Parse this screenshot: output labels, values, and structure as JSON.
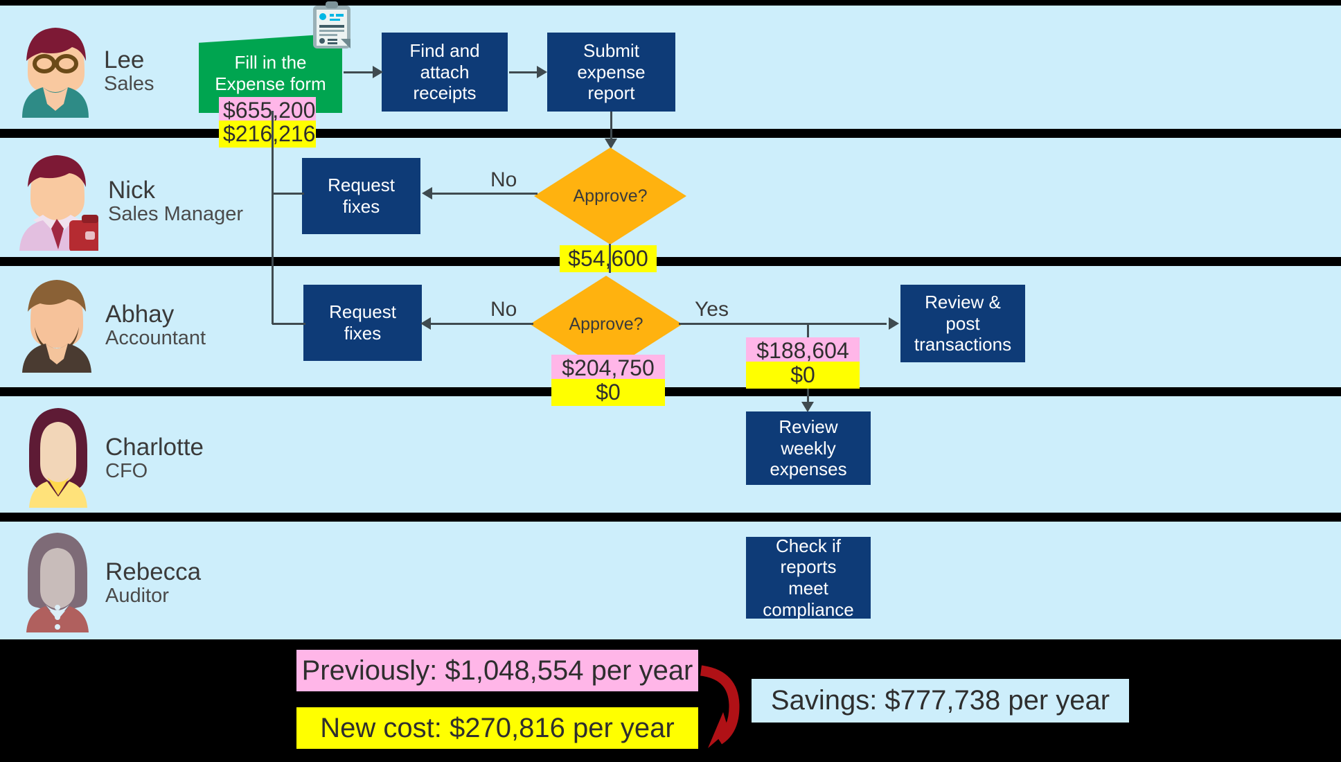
{
  "diagram": {
    "title": "Expense report process swimlane",
    "colors": {
      "lane_background": "#CDEEFB",
      "process_box": "#0E3B77",
      "start_box": "#00A550",
      "decision": "#FFB20F",
      "previous_cost_highlight": "#FFB6E8",
      "new_cost_highlight": "#FFFF00",
      "arrow": "#3f4a4f",
      "savings_arrow": "#B01116",
      "page_background": "#000000"
    }
  },
  "lanes": [
    {
      "name": "Lee",
      "role": "Sales"
    },
    {
      "name": "Nick",
      "role": "Sales Manager"
    },
    {
      "name": "Abhay",
      "role": "Accountant"
    },
    {
      "name": "Charlotte",
      "role": "CFO"
    },
    {
      "name": "Rebecca",
      "role": "Auditor"
    }
  ],
  "nodes": {
    "fill_form": "Fill in the\nExpense form",
    "find_receipts": "Find and\nattach receipts",
    "submit_report": "Submit\nexpense report",
    "request_fixes_manager": "Request\nfixes",
    "approve_manager": "Approve?",
    "request_fixes_accountant": "Request\nfixes",
    "approve_accountant": "Approve?",
    "review_post": "Review & post\ntransactions",
    "review_weekly": "Review weekly\nexpenses",
    "check_compliance": "Check if\nreports\nmeet\ncompliance"
  },
  "edge_labels": {
    "manager_no": "No",
    "accountant_no": "No",
    "accountant_yes": "Yes"
  },
  "cost_tags": [
    {
      "id": "fill_form",
      "previous": "$655,200",
      "new": "$216,216"
    },
    {
      "id": "approve_manager",
      "previous": "",
      "new": "$54,600"
    },
    {
      "id": "approve_acct",
      "previous": "$204,750",
      "new": "$0"
    },
    {
      "id": "review_post",
      "previous": "$188,604",
      "new": "$0"
    }
  ],
  "summary": {
    "previous": "Previously: $1,048,554 per year",
    "new_cost": "New cost: $270,816 per year",
    "savings": "Savings: $777,738 per year"
  },
  "icons": {
    "clipboard": "clipboard-icon",
    "savings_arrow": "curved-arrow-icon"
  }
}
